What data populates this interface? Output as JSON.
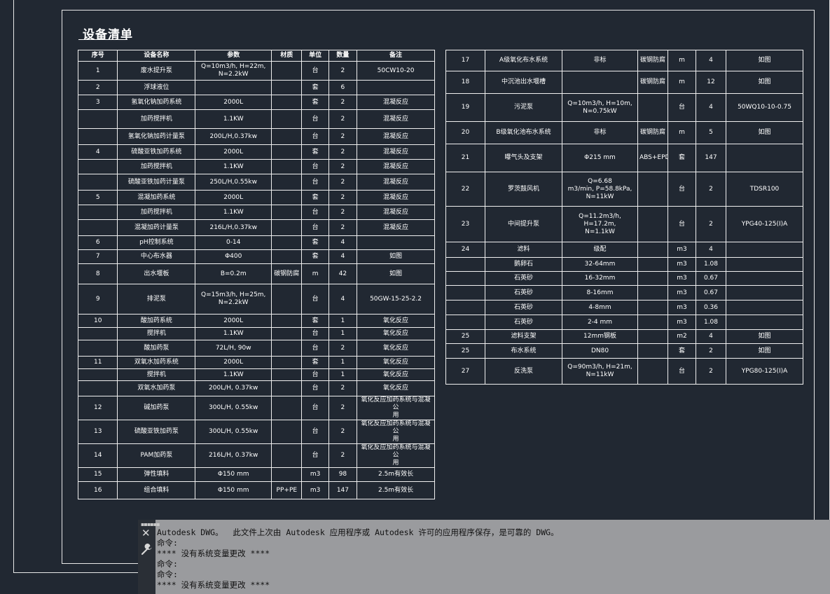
{
  "sheet_title": "设备清单",
  "headers": [
    "序号",
    "设备名称",
    "参数",
    "材质",
    "单位",
    "数量",
    "备注"
  ],
  "left_rows": [
    [
      "1",
      "废水提升泵",
      "Q=10m3/h, H=22m,\nN=2.2kW",
      "",
      "台",
      "2",
      "50CW10-20"
    ],
    [
      "2",
      "浮球液位",
      "",
      "",
      "套",
      "6",
      ""
    ],
    [
      "3",
      "氢氧化钠加药系统",
      "2000L",
      "",
      "套",
      "2",
      "混凝反应"
    ],
    [
      "",
      "加药搅拌机",
      "1.1KW",
      "",
      "台",
      "2",
      "混凝反应"
    ],
    [
      "",
      "氢氧化钠加药计量泵",
      "200L/H,0.37kw",
      "",
      "台",
      "2",
      "混凝反应"
    ],
    [
      "4",
      "硫酸亚铁加药系统",
      "2000L",
      "",
      "套",
      "2",
      "混凝反应"
    ],
    [
      "",
      "加药搅拌机",
      "1.1KW",
      "",
      "台",
      "2",
      "混凝反应"
    ],
    [
      "",
      "硫酸亚铁加药计量泵",
      "250L/H,0.55kw",
      "",
      "台",
      "2",
      "混凝反应"
    ],
    [
      "5",
      "混凝加药系统",
      "2000L",
      "",
      "套",
      "2",
      "混凝反应"
    ],
    [
      "",
      "加药搅拌机",
      "1.1KW",
      "",
      "台",
      "2",
      "混凝反应"
    ],
    [
      "",
      "混凝加药计量泵",
      "216L/H,0.37kw",
      "",
      "台",
      "2",
      "混凝反应"
    ],
    [
      "6",
      "pH控制系统",
      "0-14",
      "",
      "套",
      "4",
      ""
    ],
    [
      "7",
      "中心布水器",
      "Φ400",
      "",
      "套",
      "4",
      "如图"
    ],
    [
      "8",
      "出水堰板",
      "B=0.2m",
      "碳钢防腐",
      "m",
      "42",
      "如图"
    ],
    [
      "9",
      "排泥泵",
      "Q=15m3/h, H=25m,\nN=2.2kW",
      "",
      "台",
      "4",
      "50GW-15-25-2.2"
    ],
    [
      "10",
      "酸加药系统",
      "2000L",
      "",
      "套",
      "1",
      "氧化反应"
    ],
    [
      "",
      "搅拌机",
      "1.1KW",
      "",
      "台",
      "1",
      "氧化反应"
    ],
    [
      "",
      "酸加药泵",
      "72L/H, 90w",
      "",
      "台",
      "2",
      "氧化反应"
    ],
    [
      "11",
      "双氧水加药系统",
      "2000L",
      "",
      "套",
      "1",
      "氧化反应"
    ],
    [
      "",
      "搅拌机",
      "1.1KW",
      "",
      "台",
      "1",
      "氧化反应"
    ],
    [
      "",
      "双氧水加药泵",
      "200L/H, 0.37kw",
      "",
      "台",
      "2",
      "氧化反应"
    ],
    [
      "12",
      "碱加药泵",
      "300L/H, 0.55kw",
      "",
      "台",
      "2",
      "氧化反应加药系统与混凝公\n用"
    ],
    [
      "13",
      "硫酸亚铁加药泵",
      "300L/H, 0.55kw",
      "",
      "台",
      "2",
      "氧化反应加药系统与混凝公\n用"
    ],
    [
      "14",
      "PAM加药泵",
      "216L/H, 0.37kw",
      "",
      "台",
      "2",
      "氧化反应加药系统与混凝公\n用"
    ],
    [
      "15",
      "弹性填料",
      "Φ150 mm",
      "",
      "m3",
      "98",
      "2.5m有效长"
    ],
    [
      "16",
      "组合填料",
      "Φ150 mm",
      "PP+PE",
      "m3",
      "147",
      "2.5m有效长"
    ]
  ],
  "right_rows": [
    [
      "17",
      "A级氧化布水系统",
      "非标",
      "碳钢防腐",
      "m",
      "4",
      "如图"
    ],
    [
      "18",
      "中沉池出水堰槽",
      "",
      "碳钢防腐",
      "m",
      "12",
      "如图"
    ],
    [
      "19",
      "污泥泵",
      "Q=10m3/h, H=10m,\nN=0.75kW",
      "",
      "台",
      "4",
      "50WQ10-10-0.75"
    ],
    [
      "20",
      "B级氧化池布水系统",
      "非标",
      "碳钢防腐",
      "m",
      "5",
      "如图"
    ],
    [
      "21",
      "曝气头及支架",
      "Φ215 mm",
      "ABS+EPDM",
      "套",
      "147",
      ""
    ],
    [
      "22",
      "罗茨鼓风机",
      "Q=6.68\nm3/min, P=58.8kPa, N=11kW",
      "",
      "台",
      "2",
      "TDSR100"
    ],
    [
      "23",
      "中间提升泵",
      "Q=11.2m3/h, H=17.2m,\nN=1.1kW",
      "",
      "台",
      "2",
      "YPG40-125(I)A"
    ],
    [
      "24",
      "滤料",
      "级配",
      "",
      "m3",
      "4",
      ""
    ],
    [
      "",
      "鹅卵石",
      "32-64mm",
      "",
      "m3",
      "1.08",
      ""
    ],
    [
      "",
      "石英砂",
      "16-32mm",
      "",
      "m3",
      "0.67",
      ""
    ],
    [
      "",
      "石英砂",
      "8-16mm",
      "",
      "m3",
      "0.67",
      ""
    ],
    [
      "",
      "石英砂",
      "4-8mm",
      "",
      "m3",
      "0.36",
      ""
    ],
    [
      "",
      "石英砂",
      "2-4 mm",
      "",
      "m3",
      "1.08",
      ""
    ],
    [
      "25",
      "滤料支架",
      "12mm钢板",
      "",
      "m2",
      "4",
      "如图"
    ],
    [
      "25",
      "布水系统",
      "DN80",
      "",
      "套",
      "2",
      "如图"
    ],
    [
      "27",
      "反洗泵",
      "Q=90m3/h, H=21m, N=11kW",
      "",
      "台",
      "2",
      "YPG80-125(I)A"
    ]
  ],
  "command_line": {
    "lines": [
      "Autodesk DWG。  此文件上次由 Autodesk 应用程序或 Autodesk 许可的应用程序保存，是可靠的 DWG。",
      "命令:",
      "**** 没有系统变量更改 ****",
      "命令:",
      "命令:",
      "**** 没有系统变量更改 ****"
    ]
  },
  "icons": {
    "grip": "grip-icon",
    "close": "close-icon",
    "customize": "wrench-icon"
  },
  "colors": {
    "background": "#212832",
    "lines": "#ffffff",
    "command_panel": "#9a9b9e"
  }
}
